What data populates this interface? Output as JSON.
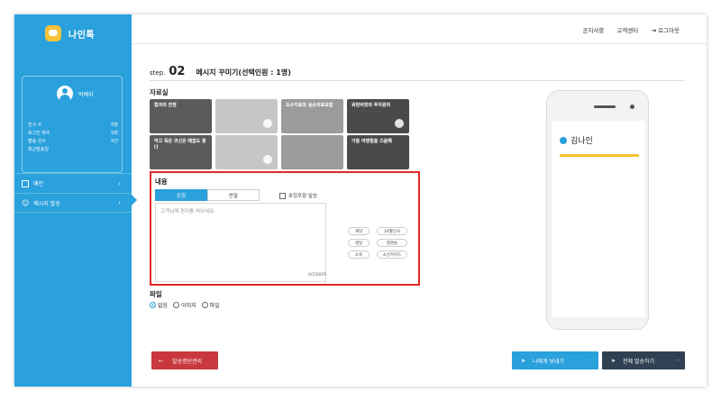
{
  "app": {
    "title": "나인톡"
  },
  "header": {
    "notice": "공지사항",
    "support": "고객센터",
    "logout": "로그아웃"
  },
  "profile": {
    "name": "박예지"
  },
  "stats": [
    {
      "label": "친구 수",
      "value": "0명"
    },
    {
      "label": "로그인 횟수",
      "value": "0회"
    },
    {
      "label": "발송 건수",
      "value": "0건"
    },
    {
      "label": "최근발송일",
      "value": ""
    }
  ],
  "sidebar": {
    "items": [
      {
        "label": "메인"
      },
      {
        "label": "메시지 발송"
      }
    ]
  },
  "step": {
    "label": "step.",
    "number": "02",
    "title": "메시지 꾸미기(선택인원 : 1명)"
  },
  "sections": {
    "materials": "자료실",
    "content": "내용",
    "file": "파일"
  },
  "thumbs": [
    {
      "title": "협과의 전쟁",
      "sub": ""
    },
    {
      "title": "",
      "sub": ""
    },
    {
      "title": "도수치료와 실손의료보험",
      "sub": ""
    },
    {
      "title": "워런버핏의 투자원칙",
      "sub": ""
    },
    {
      "title": "먹고 죽은 귀신은 때깔도 좋다",
      "sub": ""
    },
    {
      "title": "",
      "sub": ""
    },
    {
      "title": "",
      "sub": ""
    },
    {
      "title": "가을 여행철을 즈음해",
      "sub": ""
    }
  ],
  "tabs": {
    "active": "존칭",
    "inactive": "반말"
  },
  "checkbox": {
    "label": "호칭포함 발송"
  },
  "textarea": {
    "placeholder": "고객님께 편지를 써보세요."
  },
  "counter": "0/1500자",
  "pills": [
    "계약",
    "10월인사",
    "생일",
    "청명송",
    "소속",
    "소신가이드"
  ],
  "radios": [
    {
      "label": "없음",
      "checked": true
    },
    {
      "label": "이미지",
      "checked": false
    },
    {
      "label": "파일",
      "checked": false
    }
  ],
  "phone": {
    "user": "김나인"
  },
  "buttons": {
    "back": "발송명단관리",
    "send_me": "나에게 보내기",
    "send_all": "전체 발송하기"
  },
  "colors": {
    "primary": "#2aa1dc",
    "danger": "#c9383d",
    "dark": "#2f4152",
    "highlight": "#e0262b",
    "accent": "#f5c330"
  }
}
